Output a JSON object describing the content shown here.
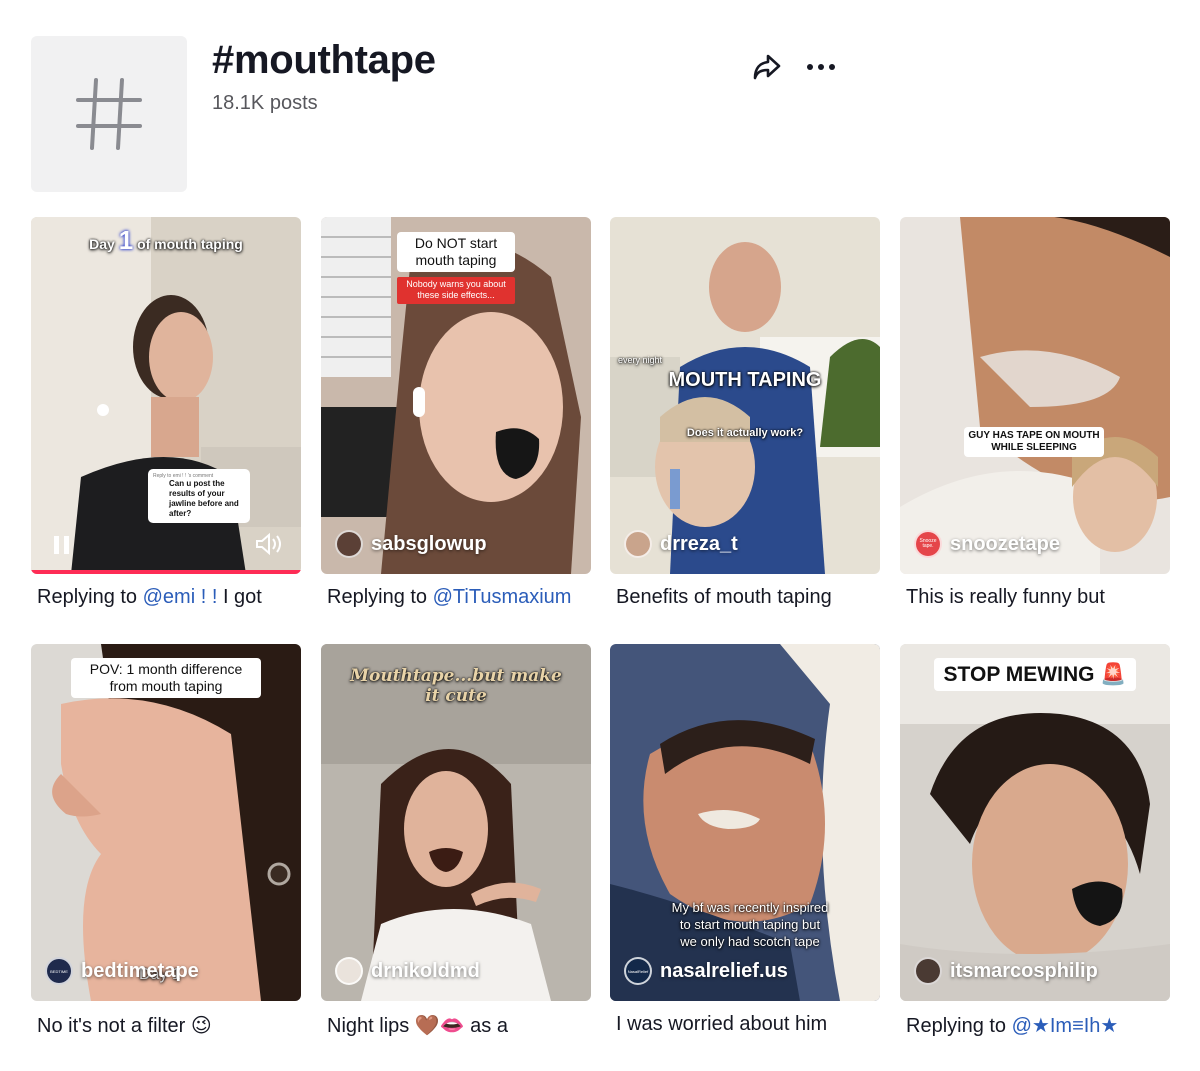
{
  "header": {
    "title": "#mouthtape",
    "posts_count": "18.1K posts",
    "icons": {
      "avatar": "hashtag-icon",
      "share": "share-arrow-icon",
      "more": "more-dots-icon"
    }
  },
  "videos": [
    {
      "author": "",
      "overlay_top": "Day",
      "overlay_num": "1",
      "overlay_rest": "of mouth taping",
      "reply_header": "Reply to emi ! ! 's comment",
      "reply_text": "Can u post the results of your jawline before and after?",
      "caption_prefix": "Replying to ",
      "caption_mention": "@emi ! !",
      "caption_suffix": " I got"
    },
    {
      "author": "sabsglowup",
      "overlay_title": "Do NOT start mouth taping",
      "overlay_sub": "Nobody warns you about these side effects...",
      "caption_prefix": "Replying to ",
      "caption_mention": "@TiTusmaxium",
      "caption_suffix": ""
    },
    {
      "author": "drreza_t",
      "overlay_small": "every night",
      "overlay_title": "MOUTH TAPING",
      "overlay_sub": "Does it actually work?",
      "caption_prefix": "Benefits of mouth taping",
      "caption_mention": "",
      "caption_suffix": ""
    },
    {
      "author": "snoozetape",
      "author_badge": "Snooze tape.",
      "overlay_title": "GUY HAS TAPE ON MOUTH WHILE SLEEPING",
      "caption_prefix": "This is really funny but",
      "caption_mention": "",
      "caption_suffix": ""
    },
    {
      "author": "bedtimetape",
      "author_badge": "BEDTIME",
      "overlay_title": "POV: 1 month difference from mouth taping",
      "overlay_bottom": "Day 1",
      "caption_prefix": "No it's not a filter 😉",
      "caption_mention": "",
      "caption_suffix": ""
    },
    {
      "author": "drnikoldmd",
      "overlay_title": "Mouthtape...but make it cute",
      "caption_prefix": "Night lips 🤎👄 as a",
      "caption_mention": "",
      "caption_suffix": ""
    },
    {
      "author": "nasalrelief.us",
      "author_badge": "NasalRelief",
      "overlay_title": "My bf was recently inspired to start mouth taping but we only had scotch tape",
      "caption_prefix": "I was worried about him",
      "caption_mention": "",
      "caption_suffix": ""
    },
    {
      "author": "itsmarcosphilip",
      "overlay_title": "STOP MEWING 🚨",
      "caption_prefix": "Replying to ",
      "caption_mention": "@★Im≡Ih★",
      "caption_suffix": ""
    }
  ],
  "colors": {
    "mention": "#2b5db9",
    "text": "#161823",
    "muted": "#57575c",
    "avatar_bg": "#f1f1f2"
  }
}
